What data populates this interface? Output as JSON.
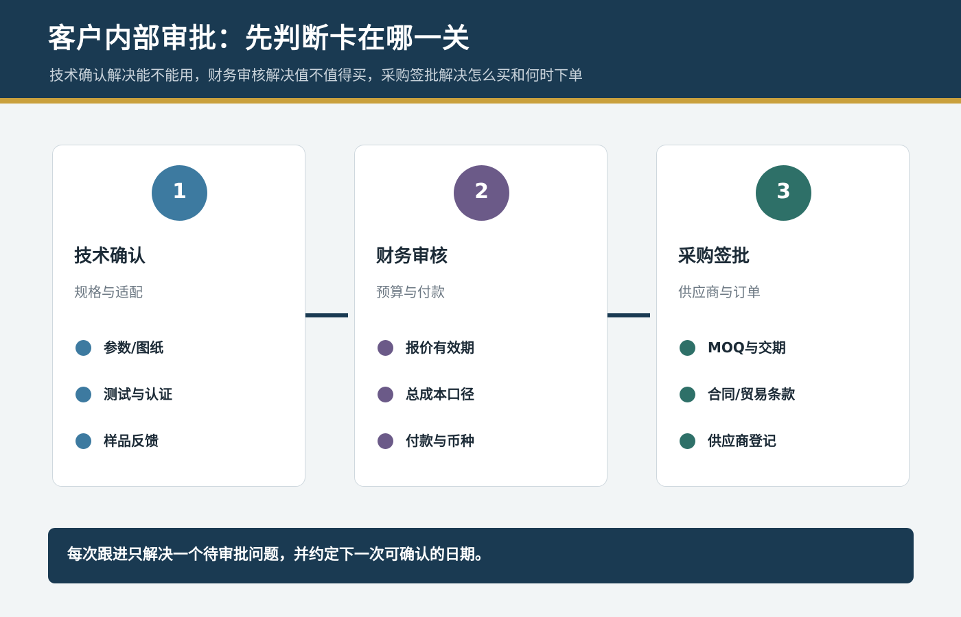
{
  "header": {
    "title": "客户内部审批：先判断卡在哪一关",
    "subtitle": "技术确认解决能不能用，财务审核解决值不值得买，采购签批解决怎么买和何时下单"
  },
  "steps": [
    {
      "number": "1",
      "title": "技术确认",
      "subtitle": "规格与适配",
      "color": "#3d7aa0",
      "items": [
        "参数/图纸",
        "测试与认证",
        "样品反馈"
      ]
    },
    {
      "number": "2",
      "title": "财务审核",
      "subtitle": "预算与付款",
      "color": "#6b5a88",
      "items": [
        "报价有效期",
        "总成本口径",
        "付款与币种"
      ]
    },
    {
      "number": "3",
      "title": "采购签批",
      "subtitle": "供应商与订单",
      "color": "#2e7068",
      "items": [
        "MOQ与交期",
        "合同/贸易条款",
        "供应商登记"
      ]
    }
  ],
  "footer": {
    "note": "每次跟进只解决一个待审批问题，并约定下一次可确认的日期。"
  },
  "colors": {
    "header_bg": "#1a3a52",
    "accent": "#c9a03d",
    "page_bg": "#f2f5f6"
  }
}
